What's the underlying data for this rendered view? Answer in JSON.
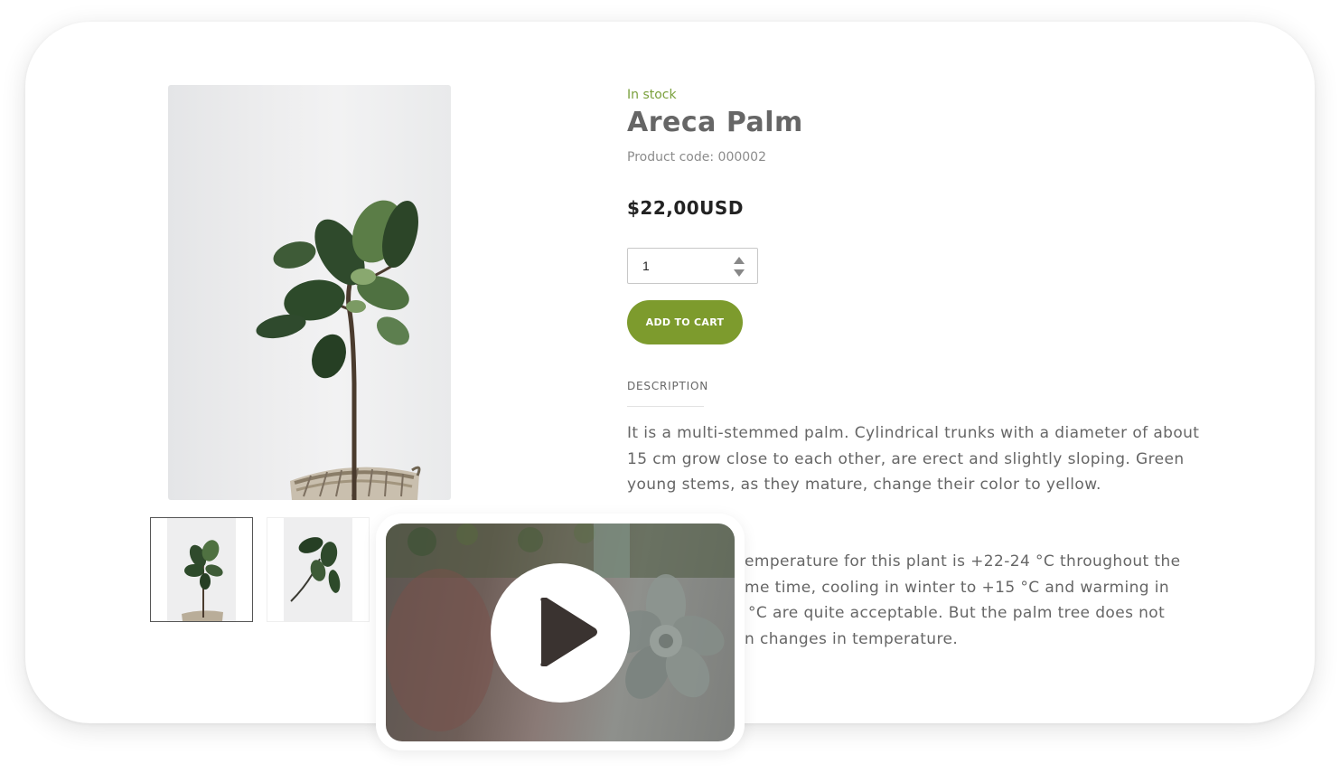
{
  "product": {
    "stock_status": "In stock",
    "name": "Areca Palm",
    "code": "Product code: 000002",
    "price": "$22,00USD"
  },
  "quantity": {
    "value": "1"
  },
  "cart": {
    "button_label": "ADD TO CART"
  },
  "description": {
    "heading": "DESCRIPTION",
    "paragraph_1": "It is a multi-stemmed palm. Cylindrical trunks with a diameter of about 15 cm grow close to each other, are erect and slightly sloping. Green young stems, as they mature, change their color to yellow.",
    "paragraph_2_visible_lines": [
      "emperature for this plant is +22-24 °C throughout the",
      "me time, cooling in winter to +15 °C and warming in",
      "°C are quite acceptable. But the palm tree does not",
      "n changes in temperature."
    ]
  },
  "gallery": {
    "thumbnail_count": 2,
    "selected_index": 0
  },
  "colors": {
    "accent": "#7d9b2d",
    "stock_green": "#7aa03c",
    "text": "#666666"
  },
  "icons": {
    "play": "play-icon",
    "spinner_up": "caret-up-icon",
    "spinner_down": "caret-down-icon"
  }
}
